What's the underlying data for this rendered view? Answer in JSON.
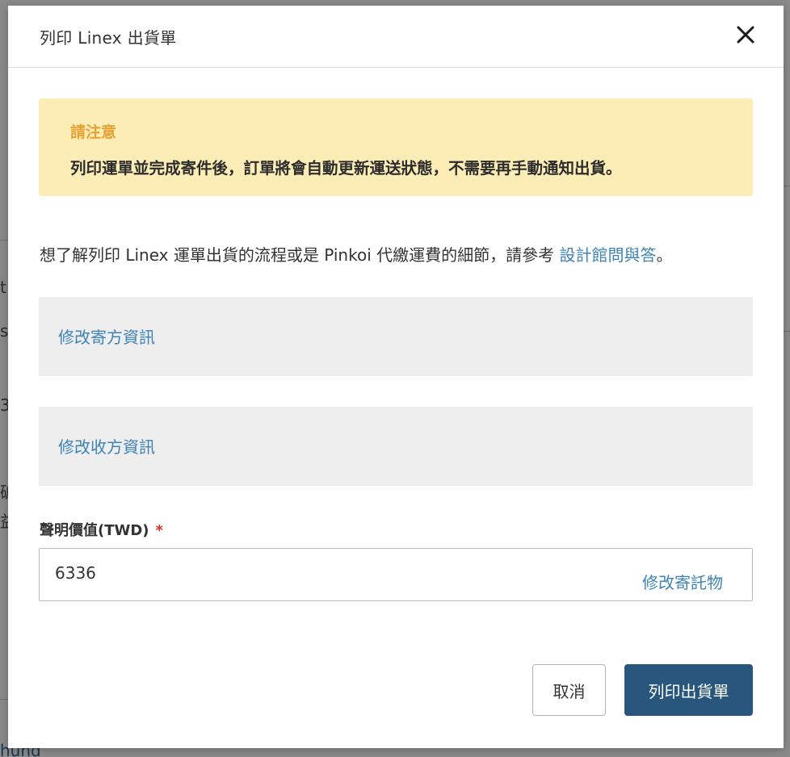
{
  "background": {
    "fragments": [
      "t",
      "sh",
      "3",
      "破",
      "益",
      "hund"
    ]
  },
  "modal": {
    "title": "列印 Linex 出貨單",
    "close_icon": "close-icon",
    "notice": {
      "title": "請注意",
      "body": "列印運單並完成寄件後，訂單將會自動更新運送狀態，不需要再手動通知出貨。"
    },
    "info": {
      "text": "想了解列印 Linex 運單出貨的流程或是 Pinkoi 代繳運費的細節，請參考 ",
      "link_text": "設計館問與答",
      "suffix": "。"
    },
    "sender_panel": {
      "link_text": "修改寄方資訊"
    },
    "receiver_panel": {
      "link_text": "修改收方資訊"
    },
    "declared_value": {
      "label": "聲明價值(TWD)",
      "required_mark": "*",
      "value": "6336",
      "edit_link": "修改寄託物"
    },
    "buttons": {
      "cancel": "取消",
      "print": "列印出貨單"
    }
  },
  "colors": {
    "link": "#3d83b7",
    "notice_bg": "#fcedb6",
    "notice_title": "#e8a234",
    "primary_button": "#28567d",
    "required": "#d0312d"
  }
}
